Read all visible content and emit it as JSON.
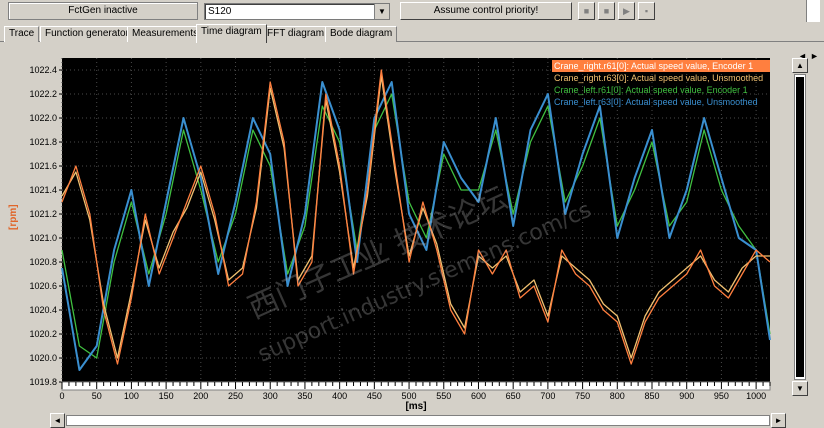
{
  "toolbar": {
    "fctgen_status": "FctGen inactive",
    "device_value": "S120",
    "assume_control_label": "Assume control priority!",
    "buttons": [
      "stop-icon",
      "stop-icon",
      "play-icon",
      "pause-icon"
    ]
  },
  "tabs": [
    {
      "label": "Trace"
    },
    {
      "label": "Function generator"
    },
    {
      "label": "Measurements"
    },
    {
      "label": "Time diagram",
      "active": true
    },
    {
      "label": "FFT diagram"
    },
    {
      "label": "Bode diagram"
    }
  ],
  "tab_nav": {
    "prev": "◄",
    "next": "►"
  },
  "colors": {
    "plot_bg": "#000000",
    "grid": "#4a4a4a",
    "panel_bg": "#d4d0c8",
    "axis_text": "#000000",
    "ylabel": "#e0662a"
  },
  "watermark": {
    "line1": "西门子工业 技术论坛",
    "line2": "support.industry.siemens.com/cs"
  },
  "chart_data": {
    "type": "line",
    "xlabel": "[ms]",
    "ylabel": "[rpm]",
    "xlim": [
      0,
      1020
    ],
    "ylim": [
      1019.8,
      1022.5
    ],
    "xticks": [
      0,
      50,
      100,
      150,
      200,
      250,
      300,
      350,
      400,
      450,
      500,
      550,
      600,
      650,
      700,
      750,
      800,
      850,
      900,
      950,
      1000
    ],
    "yticks": [
      1019.8,
      1020.0,
      1020.2,
      1020.4,
      1020.6,
      1020.8,
      1021.0,
      1021.2,
      1021.4,
      1021.6,
      1021.8,
      1022.0,
      1022.2,
      1022.4
    ],
    "legend_position": "top-right",
    "grid": true,
    "series": [
      {
        "name": "Crane_right.r61[0]: Actual speed value, Encoder 1",
        "color": "#ff7f3f",
        "legend_highlight": "#ff7f3f",
        "x": [
          0,
          20,
          40,
          60,
          80,
          100,
          120,
          140,
          160,
          180,
          200,
          220,
          240,
          260,
          280,
          300,
          320,
          340,
          360,
          380,
          400,
          420,
          440,
          460,
          480,
          500,
          520,
          540,
          560,
          580,
          600,
          620,
          640,
          660,
          680,
          700,
          720,
          740,
          760,
          780,
          800,
          820,
          840,
          860,
          880,
          900,
          920,
          940,
          960,
          980,
          1000,
          1020
        ],
        "y": [
          1021.3,
          1021.6,
          1021.2,
          1020.4,
          1019.95,
          1020.5,
          1021.2,
          1020.7,
          1021.0,
          1021.3,
          1021.6,
          1021.2,
          1020.6,
          1020.7,
          1021.3,
          1022.3,
          1021.8,
          1020.6,
          1020.8,
          1022.2,
          1021.6,
          1020.7,
          1021.4,
          1022.4,
          1021.6,
          1020.8,
          1021.3,
          1020.9,
          1020.4,
          1020.2,
          1020.9,
          1020.7,
          1020.9,
          1020.5,
          1020.6,
          1020.3,
          1020.9,
          1020.7,
          1020.6,
          1020.4,
          1020.3,
          1019.95,
          1020.3,
          1020.5,
          1020.6,
          1020.7,
          1020.9,
          1020.6,
          1020.5,
          1020.7,
          1020.9,
          1020.8
        ]
      },
      {
        "name": "Crane_right.r63[0]: Actual speed value, Unsmoothed",
        "color": "#f0c070",
        "x": [
          0,
          20,
          40,
          60,
          80,
          100,
          120,
          140,
          160,
          180,
          200,
          220,
          240,
          260,
          280,
          300,
          320,
          340,
          360,
          380,
          400,
          420,
          440,
          460,
          480,
          500,
          520,
          540,
          560,
          580,
          600,
          620,
          640,
          660,
          680,
          700,
          720,
          740,
          760,
          780,
          800,
          820,
          840,
          860,
          880,
          900,
          920,
          940,
          960,
          980,
          1000,
          1020
        ],
        "y": [
          1021.35,
          1021.55,
          1021.15,
          1020.45,
          1020.0,
          1020.55,
          1021.15,
          1020.75,
          1021.05,
          1021.25,
          1021.55,
          1021.15,
          1020.65,
          1020.75,
          1021.25,
          1022.25,
          1021.75,
          1020.65,
          1020.85,
          1022.15,
          1021.55,
          1020.75,
          1021.35,
          1022.35,
          1021.55,
          1020.85,
          1021.25,
          1020.95,
          1020.45,
          1020.25,
          1020.85,
          1020.75,
          1020.85,
          1020.55,
          1020.65,
          1020.35,
          1020.85,
          1020.75,
          1020.65,
          1020.45,
          1020.35,
          1020.0,
          1020.35,
          1020.55,
          1020.65,
          1020.75,
          1020.85,
          1020.65,
          1020.55,
          1020.75,
          1020.85,
          1020.85
        ]
      },
      {
        "name": "Crane_left.r61[0]: Actual speed value, Encoder 1",
        "color": "#40c040",
        "x": [
          0,
          25,
          50,
          75,
          100,
          125,
          150,
          175,
          200,
          225,
          250,
          275,
          300,
          325,
          350,
          375,
          400,
          425,
          450,
          475,
          500,
          525,
          550,
          575,
          600,
          625,
          650,
          675,
          700,
          725,
          750,
          775,
          800,
          825,
          850,
          875,
          900,
          925,
          950,
          975,
          1000,
          1020
        ],
        "y": [
          1020.9,
          1020.1,
          1020.0,
          1020.8,
          1021.3,
          1020.7,
          1021.2,
          1021.9,
          1021.4,
          1020.8,
          1021.2,
          1021.9,
          1021.6,
          1020.7,
          1021.1,
          1022.1,
          1021.8,
          1020.9,
          1021.9,
          1022.2,
          1021.3,
          1021.0,
          1021.7,
          1021.4,
          1021.4,
          1021.9,
          1021.2,
          1021.8,
          1022.1,
          1021.3,
          1021.6,
          1022.0,
          1021.1,
          1021.4,
          1021.8,
          1021.1,
          1021.3,
          1021.9,
          1021.4,
          1021.1,
          1020.9,
          1020.2
        ]
      },
      {
        "name": "Crane_left.r63[0]: Actual speed value, Unsmoothed",
        "color": "#3a8fd0",
        "x": [
          0,
          25,
          50,
          75,
          100,
          125,
          150,
          175,
          200,
          225,
          250,
          275,
          300,
          325,
          350,
          375,
          400,
          425,
          450,
          475,
          500,
          525,
          550,
          575,
          600,
          625,
          650,
          675,
          700,
          725,
          750,
          775,
          800,
          825,
          850,
          875,
          900,
          925,
          950,
          975,
          1000,
          1020
        ],
        "y": [
          1020.75,
          1019.9,
          1020.1,
          1020.9,
          1021.4,
          1020.6,
          1021.3,
          1022.0,
          1021.5,
          1020.7,
          1021.3,
          1022.0,
          1021.7,
          1020.6,
          1021.2,
          1022.3,
          1021.9,
          1020.8,
          1022.0,
          1022.3,
          1021.2,
          1020.9,
          1021.8,
          1021.5,
          1021.3,
          1022.0,
          1021.1,
          1021.9,
          1022.2,
          1021.2,
          1021.7,
          1022.1,
          1021.0,
          1021.5,
          1021.9,
          1021.0,
          1021.4,
          1022.0,
          1021.5,
          1021.0,
          1020.9,
          1020.15
        ]
      }
    ]
  }
}
